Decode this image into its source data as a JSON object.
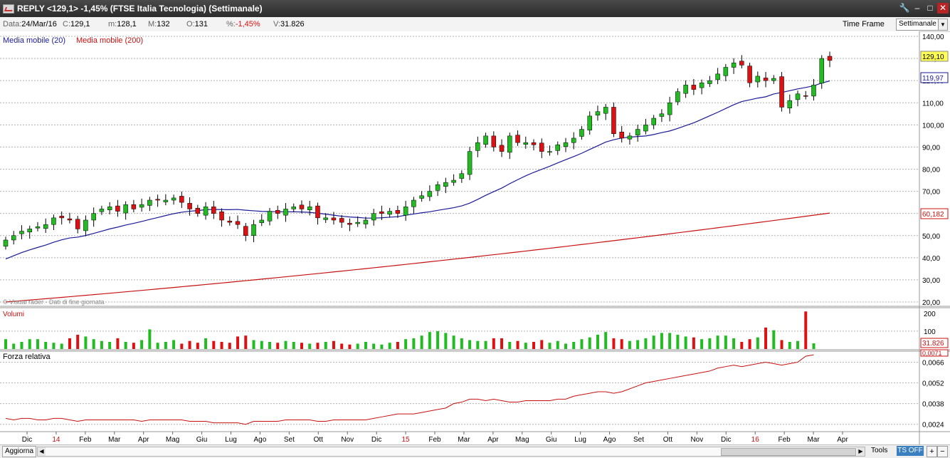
{
  "window": {
    "title": "REPLY <129,1> -1,45%  (FTSE Italia Tecnologia)  (Settimanale)",
    "buttons": [
      "🔧",
      "–",
      "□",
      "✕"
    ]
  },
  "infobar": {
    "data_label": "Data:",
    "data_value": "24/Mar/16",
    "c_label": "C:",
    "c_value": "129,1",
    "m_label": "m:",
    "m_value": "128,1",
    "M_label": "M:",
    "M_value": "132",
    "o_label": "O:",
    "o_value": "131",
    "pct_label": "%:",
    "pct_value": "-1,45%",
    "v_label": "V:",
    "v_value": "31.826",
    "timeframe_label": "Time Frame",
    "timeframe_value": "Settimanale"
  },
  "indicators": {
    "ma20_label": "Media mobile (20)",
    "ma200_label": "Media mobile (200)",
    "watermark": "© Visual rader - Dati di fine giornata",
    "volume_label": "Volumi",
    "rs_label": "Forza relativa"
  },
  "colors": {
    "up": "#22bb22",
    "down": "#dd1111",
    "ma20": "#1a1a9a",
    "ma200": "#c81010",
    "rs": "#c81010"
  },
  "price_axis": {
    "ticks": [
      "140,00",
      "130,00",
      "120,00",
      "110,00",
      "100,00",
      "90,00",
      "80,00",
      "70,00",
      "60,00",
      "50,00",
      "40,00",
      "30,00",
      "20,00"
    ],
    "last_price": "129,10",
    "ma20_value": "119,97",
    "ma200_value": "60,182"
  },
  "volume_axis": {
    "ticks": [
      "200",
      "100"
    ],
    "last": "31.826"
  },
  "rs_axis": {
    "ticks": [
      "0,0066",
      "0,0052",
      "0,0038",
      "0,0024"
    ],
    "last": "0,0071"
  },
  "time_axis": [
    "Dic",
    "14",
    "Feb",
    "Mar",
    "Apr",
    "Mag",
    "Giu",
    "Lug",
    "Ago",
    "Set",
    "Ott",
    "Nov",
    "Dic",
    "15",
    "Feb",
    "Mar",
    "Apr",
    "Mag",
    "Giu",
    "Lug",
    "Ago",
    "Set",
    "Ott",
    "Nov",
    "Dic",
    "16",
    "Feb",
    "Mar",
    "Apr"
  ],
  "time_axis_year_marks": [
    "14",
    "15",
    "16"
  ],
  "bottombar": {
    "refresh": "Aggiorna",
    "tools": "Tools",
    "ts": "TS OFF",
    "plus": "+",
    "minus": "−"
  },
  "chart_data": {
    "type": "candlestick",
    "price_range": [
      20,
      140
    ],
    "closes": [
      48,
      50,
      52,
      53,
      54,
      55,
      58,
      58,
      57,
      53,
      57,
      60,
      62,
      63,
      61,
      64,
      62,
      64,
      66,
      66,
      66,
      67,
      65,
      62,
      60,
      63,
      60,
      57,
      56,
      55,
      50,
      55,
      57,
      61,
      60,
      62,
      63,
      62,
      63,
      58,
      58,
      57,
      56,
      55,
      56,
      57,
      60,
      60,
      61,
      60,
      63,
      66,
      68,
      70,
      73,
      74,
      75,
      78,
      88,
      92,
      95,
      90,
      88,
      95,
      92,
      92,
      91,
      88,
      88,
      91,
      92,
      94,
      98,
      104,
      106,
      108,
      96,
      94,
      95,
      98,
      100,
      103,
      105,
      110,
      115,
      118,
      116,
      119,
      120,
      123,
      126,
      128,
      127,
      119,
      122,
      120,
      121,
      108,
      111,
      114,
      113,
      118,
      130,
      129.1
    ],
    "volumes": [
      55,
      30,
      40,
      55,
      55,
      40,
      35,
      30,
      60,
      80,
      70,
      55,
      45,
      40,
      60,
      40,
      35,
      50,
      110,
      35,
      40,
      50,
      30,
      45,
      35,
      60,
      45,
      40,
      35,
      70,
      75,
      50,
      45,
      40,
      35,
      45,
      40,
      35,
      30,
      35,
      40,
      45,
      30,
      25,
      30,
      40,
      30,
      25,
      35,
      40,
      55,
      60,
      75,
      95,
      100,
      90,
      75,
      60,
      50,
      45,
      45,
      60,
      60,
      40,
      45,
      35,
      40,
      50,
      35,
      45,
      30,
      40,
      55,
      65,
      80,
      95,
      60,
      55,
      45,
      50,
      60,
      75,
      90,
      90,
      80,
      70,
      65,
      55,
      60,
      75,
      75,
      60,
      40,
      55,
      65,
      120,
      105,
      50,
      40,
      45,
      210,
      31.8
    ],
    "rs": [
      0.0028,
      0.0027,
      0.0028,
      0.0028,
      0.0027,
      0.0027,
      0.0028,
      0.0028,
      0.0027,
      0.0026,
      0.0027,
      0.0027,
      0.0027,
      0.0027,
      0.0027,
      0.0027,
      0.0027,
      0.0026,
      0.0027,
      0.0027,
      0.0027,
      0.0027,
      0.0027,
      0.0026,
      0.0026,
      0.0026,
      0.0025,
      0.0025,
      0.0025,
      0.0025,
      0.0024,
      0.0026,
      0.0026,
      0.0026,
      0.0026,
      0.0027,
      0.0027,
      0.0027,
      0.0027,
      0.0026,
      0.0026,
      0.0027,
      0.0027,
      0.0027,
      0.0027,
      0.0027,
      0.0028,
      0.0029,
      0.003,
      0.0031,
      0.0031,
      0.0031,
      0.0032,
      0.0033,
      0.0034,
      0.0035,
      0.0038,
      0.0039,
      0.0041,
      0.0041,
      0.004,
      0.0041,
      0.004,
      0.0039,
      0.0039,
      0.004,
      0.004,
      0.004,
      0.004,
      0.0041,
      0.0041,
      0.0043,
      0.0044,
      0.0045,
      0.0046,
      0.0046,
      0.0045,
      0.0046,
      0.0048,
      0.005,
      0.0052,
      0.0053,
      0.0054,
      0.0055,
      0.0056,
      0.0057,
      0.0058,
      0.0059,
      0.006,
      0.0062,
      0.0063,
      0.0064,
      0.0063,
      0.0064,
      0.0065,
      0.0066,
      0.0065,
      0.0064,
      0.0065,
      0.0066,
      0.007,
      0.0071
    ],
    "rs_range": [
      0.002,
      0.0072
    ],
    "ma200_range": [
      20,
      60.182
    ],
    "ylabel": "",
    "xlabel": ""
  }
}
